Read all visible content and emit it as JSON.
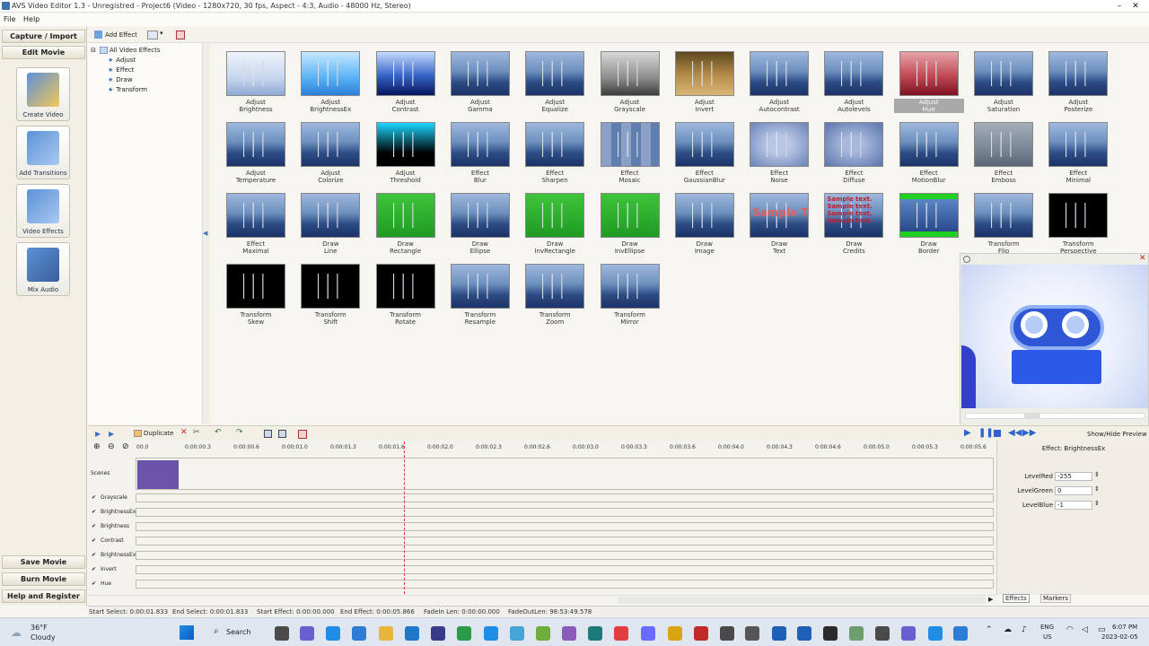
{
  "window": {
    "title": "AVS Video Editor 1.3 - Unregistred - Project6 (Video - 1280x720, 30 fps, Aspect - 4:3, Audio - 48000 Hz, Stereo)"
  },
  "menu": [
    "File",
    "Help"
  ],
  "left_panel": {
    "capture": "Capture / Import",
    "edit": "Edit Movie",
    "buttons": [
      "Create Video",
      "Add Transitions",
      "Video Effects",
      "Mix Audio"
    ],
    "save": "Save Movie",
    "burn": "Burn Movie",
    "help": "Help and Register"
  },
  "toolbar": {
    "add_effect": "Add Effect"
  },
  "tree": {
    "root": "All Video Effects",
    "children": [
      "Adjust",
      "Effect",
      "Draw",
      "Transform"
    ]
  },
  "effects": [
    {
      "l1": "Adjust",
      "l2": "Brightness"
    },
    {
      "l1": "Adjust",
      "l2": "BrightnessEx"
    },
    {
      "l1": "Adjust",
      "l2": "Contrast"
    },
    {
      "l1": "Adjust",
      "l2": "Gamma"
    },
    {
      "l1": "Adjust",
      "l2": "Equalize"
    },
    {
      "l1": "Adjust",
      "l2": "Grayscale"
    },
    {
      "l1": "Adjust",
      "l2": "Invert"
    },
    {
      "l1": "Adjust",
      "l2": "Autocontrast"
    },
    {
      "l1": "Adjust",
      "l2": "Autolevels"
    },
    {
      "l1": "Adjust",
      "l2": "Hue"
    },
    {
      "l1": "Adjust",
      "l2": "Saturation"
    },
    {
      "l1": "Adjust",
      "l2": "Posterize"
    },
    {
      "l1": "Adjust",
      "l2": "Temperature"
    },
    {
      "l1": "Adjust",
      "l2": "Colorize"
    },
    {
      "l1": "Adjust",
      "l2": "Threshold"
    },
    {
      "l1": "Effect",
      "l2": "Blur"
    },
    {
      "l1": "Effect",
      "l2": "Sharpen"
    },
    {
      "l1": "Effect",
      "l2": "Mosaic"
    },
    {
      "l1": "Effect",
      "l2": "GaussianBlur"
    },
    {
      "l1": "Effect",
      "l2": "Noise"
    },
    {
      "l1": "Effect",
      "l2": "Diffuse"
    },
    {
      "l1": "Effect",
      "l2": "MotionBlur"
    },
    {
      "l1": "Effect",
      "l2": "Emboss"
    },
    {
      "l1": "Effect",
      "l2": "Minimal"
    },
    {
      "l1": "Effect",
      "l2": "Maximal"
    },
    {
      "l1": "Draw",
      "l2": "Line"
    },
    {
      "l1": "Draw",
      "l2": "Rectangle"
    },
    {
      "l1": "Draw",
      "l2": "Ellipse"
    },
    {
      "l1": "Draw",
      "l2": "InvRectangle"
    },
    {
      "l1": "Draw",
      "l2": "InvEllipse"
    },
    {
      "l1": "Draw",
      "l2": "Image"
    },
    {
      "l1": "Draw",
      "l2": "Text"
    },
    {
      "l1": "Draw",
      "l2": "Credits"
    },
    {
      "l1": "Draw",
      "l2": "Border"
    },
    {
      "l1": "Transform",
      "l2": "Flip"
    },
    {
      "l1": "Transform",
      "l2": "Perspective"
    },
    {
      "l1": "Transform",
      "l2": "Skew"
    },
    {
      "l1": "Transform",
      "l2": "Shift"
    },
    {
      "l1": "Transform",
      "l2": "Rotate"
    },
    {
      "l1": "Transform",
      "l2": "Resample"
    },
    {
      "l1": "Transform",
      "l2": "Zoom"
    },
    {
      "l1": "Transform",
      "l2": "Mirror"
    }
  ],
  "thumb_text": {
    "draw_text": "Sample Text",
    "credits": "Sample text. Sample text. Sample text. Sample text."
  },
  "preview": {
    "show_hide": "Show/Hide Preview"
  },
  "timeline": {
    "duplicate": "Duplicate",
    "ticks": [
      "00.0",
      "0:00:00.3",
      "0:00:00.6",
      "0:00:01.0",
      "0:00:01.3",
      "0:00:01.6",
      "0:00:02.0",
      "0:00:02.3",
      "0:00:02.6",
      "0:00:03.0",
      "0:00:03.3",
      "0:00:03.6",
      "0:00:04.0",
      "0:00:04.3",
      "0:00:04.6",
      "0:00:05.0",
      "0:00:05.3",
      "0:00:05.6"
    ],
    "scenes_label": "Scenes",
    "tracks": [
      "Grayscale",
      "BrightnessEx",
      "Brightness",
      "Contrast",
      "BrightnessEx",
      "Invert",
      "Hue"
    ]
  },
  "props": {
    "title": "Effect: BrightnessEx",
    "fields": [
      {
        "label": "LevelRed",
        "value": "-255"
      },
      {
        "label": "LevelGreen",
        "value": "0"
      },
      {
        "label": "LevelBlue",
        "value": "-1"
      }
    ],
    "tabs": [
      "Effects",
      "Markers"
    ]
  },
  "status": {
    "start_select": "Start Select: 0:00:01.833",
    "end_select": "End Select: 0:00:01.833",
    "start_effect": "Start Effect: 0:00:00.000",
    "end_effect": "End Effect: 0:00:05.866",
    "fadein": "FadeIn Len: 0:00:00.000",
    "fadeout": "FadeOutLen: 98:53:49.578"
  },
  "taskbar": {
    "temp": "36°F",
    "weather": "Cloudy",
    "search": "Search",
    "lang1": "ENG",
    "lang2": "US",
    "time": "6:07 PM",
    "date": "2023-02-05"
  }
}
